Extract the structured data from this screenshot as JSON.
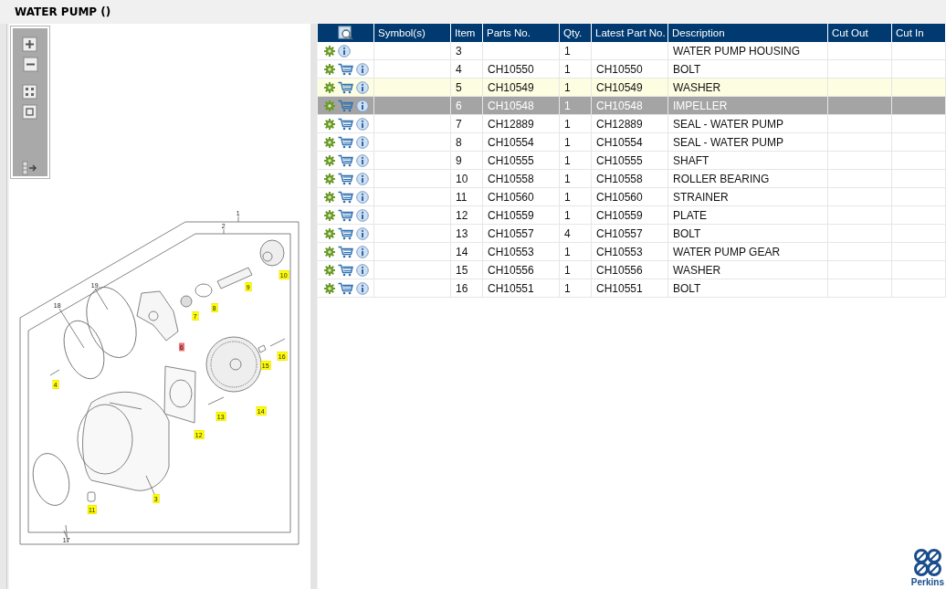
{
  "title": "WATER PUMP ()",
  "table": {
    "columns": [
      "Symbol(s)",
      "Item",
      "Parts No.",
      "Qty.",
      "Latest Part No.",
      "Description",
      "Cut Out",
      "Cut In"
    ],
    "rows": [
      {
        "item": "3",
        "parts_no": "",
        "qty": "1",
        "latest": "",
        "description": "WATER PUMP HOUSING",
        "orderable": false,
        "highlighted": false,
        "selected": false
      },
      {
        "item": "4",
        "parts_no": "CH10550",
        "qty": "1",
        "latest": "CH10550",
        "description": "BOLT",
        "orderable": true,
        "highlighted": false,
        "selected": false
      },
      {
        "item": "5",
        "parts_no": "CH10549",
        "qty": "1",
        "latest": "CH10549",
        "description": "WASHER",
        "orderable": true,
        "highlighted": true,
        "selected": false
      },
      {
        "item": "6",
        "parts_no": "CH10548",
        "qty": "1",
        "latest": "CH10548",
        "description": "IMPELLER",
        "orderable": true,
        "highlighted": false,
        "selected": true
      },
      {
        "item": "7",
        "parts_no": "CH12889",
        "qty": "1",
        "latest": "CH12889",
        "description": "SEAL - WATER PUMP",
        "orderable": true,
        "highlighted": false,
        "selected": false
      },
      {
        "item": "8",
        "parts_no": "CH10554",
        "qty": "1",
        "latest": "CH10554",
        "description": "SEAL - WATER PUMP",
        "orderable": true,
        "highlighted": false,
        "selected": false
      },
      {
        "item": "9",
        "parts_no": "CH10555",
        "qty": "1",
        "latest": "CH10555",
        "description": "SHAFT",
        "orderable": true,
        "highlighted": false,
        "selected": false
      },
      {
        "item": "10",
        "parts_no": "CH10558",
        "qty": "1",
        "latest": "CH10558",
        "description": "ROLLER BEARING",
        "orderable": true,
        "highlighted": false,
        "selected": false
      },
      {
        "item": "11",
        "parts_no": "CH10560",
        "qty": "1",
        "latest": "CH10560",
        "description": "STRAINER",
        "orderable": true,
        "highlighted": false,
        "selected": false
      },
      {
        "item": "12",
        "parts_no": "CH10559",
        "qty": "1",
        "latest": "CH10559",
        "description": "PLATE",
        "orderable": true,
        "highlighted": false,
        "selected": false
      },
      {
        "item": "13",
        "parts_no": "CH10557",
        "qty": "4",
        "latest": "CH10557",
        "description": "BOLT",
        "orderable": true,
        "highlighted": false,
        "selected": false
      },
      {
        "item": "14",
        "parts_no": "CH10553",
        "qty": "1",
        "latest": "CH10553",
        "description": "WATER PUMP GEAR",
        "orderable": true,
        "highlighted": false,
        "selected": false
      },
      {
        "item": "15",
        "parts_no": "CH10556",
        "qty": "1",
        "latest": "CH10556",
        "description": "WASHER",
        "orderable": true,
        "highlighted": false,
        "selected": false
      },
      {
        "item": "16",
        "parts_no": "CH10551",
        "qty": "1",
        "latest": "CH10551",
        "description": "BOLT",
        "orderable": true,
        "highlighted": false,
        "selected": false
      }
    ]
  },
  "callouts": [
    {
      "label": "1",
      "listed": false,
      "selected": false
    },
    {
      "label": "2",
      "listed": false,
      "selected": false
    },
    {
      "label": "10",
      "listed": true,
      "selected": false
    },
    {
      "label": "9",
      "listed": true,
      "selected": false
    },
    {
      "label": "8",
      "listed": true,
      "selected": false
    },
    {
      "label": "7",
      "listed": true,
      "selected": false
    },
    {
      "label": "6",
      "listed": false,
      "selected": true
    },
    {
      "label": "19",
      "listed": false,
      "selected": false
    },
    {
      "label": "18",
      "listed": false,
      "selected": false
    },
    {
      "label": "16",
      "listed": true,
      "selected": false
    },
    {
      "label": "15",
      "listed": true,
      "selected": false
    },
    {
      "label": "4",
      "listed": true,
      "selected": false
    },
    {
      "label": "14",
      "listed": true,
      "selected": false
    },
    {
      "label": "13",
      "listed": true,
      "selected": false
    },
    {
      "label": "12",
      "listed": true,
      "selected": false
    },
    {
      "label": "3",
      "listed": true,
      "selected": false
    },
    {
      "label": "11",
      "listed": true,
      "selected": false
    },
    {
      "label": "17",
      "listed": false,
      "selected": false
    }
  ],
  "brand": "Perkins"
}
